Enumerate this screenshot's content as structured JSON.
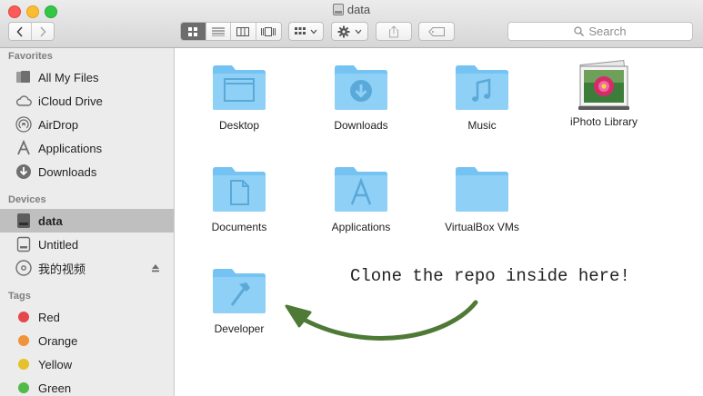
{
  "window": {
    "title": "data"
  },
  "toolbar": {
    "search_placeholder": "Search"
  },
  "sidebar": {
    "favorites_header": "Favorites",
    "favorites": [
      {
        "label": "All My Files",
        "icon": "all-files-icon"
      },
      {
        "label": "iCloud Drive",
        "icon": "cloud-icon"
      },
      {
        "label": "AirDrop",
        "icon": "airdrop-icon"
      },
      {
        "label": "Applications",
        "icon": "applications-icon"
      },
      {
        "label": "Downloads",
        "icon": "downloads-icon"
      }
    ],
    "devices_header": "Devices",
    "devices": [
      {
        "label": "data",
        "icon": "disk-icon",
        "selected": true
      },
      {
        "label": "Untitled",
        "icon": "disk-icon",
        "selected": false
      },
      {
        "label": "我的视频",
        "icon": "dvd-icon",
        "selected": false
      }
    ],
    "tags_header": "Tags",
    "tags": [
      {
        "label": "Red",
        "color": "#e4484d"
      },
      {
        "label": "Orange",
        "color": "#f1933a"
      },
      {
        "label": "Yellow",
        "color": "#e5c229"
      },
      {
        "label": "Green",
        "color": "#52b94b"
      }
    ]
  },
  "files": [
    {
      "label": "Desktop",
      "icon": "desktop-folder-icon"
    },
    {
      "label": "Downloads",
      "icon": "downloads-folder-icon"
    },
    {
      "label": "Music",
      "icon": "music-folder-icon"
    },
    {
      "label": "iPhoto Library",
      "icon": "iphoto-library-icon"
    },
    {
      "label": "Documents",
      "icon": "documents-folder-icon"
    },
    {
      "label": "Applications",
      "icon": "applications-folder-icon"
    },
    {
      "label": "VirtualBox VMs",
      "icon": "folder-icon"
    },
    {
      "label": "Developer",
      "icon": "developer-folder-icon"
    }
  ],
  "annotation": {
    "text": "Clone the repo inside here!",
    "arrow_color": "#4e7a36"
  },
  "colors": {
    "folder": "#74c3f2",
    "folder_light": "#9fd8f8",
    "selection": "#bfbfbf"
  }
}
